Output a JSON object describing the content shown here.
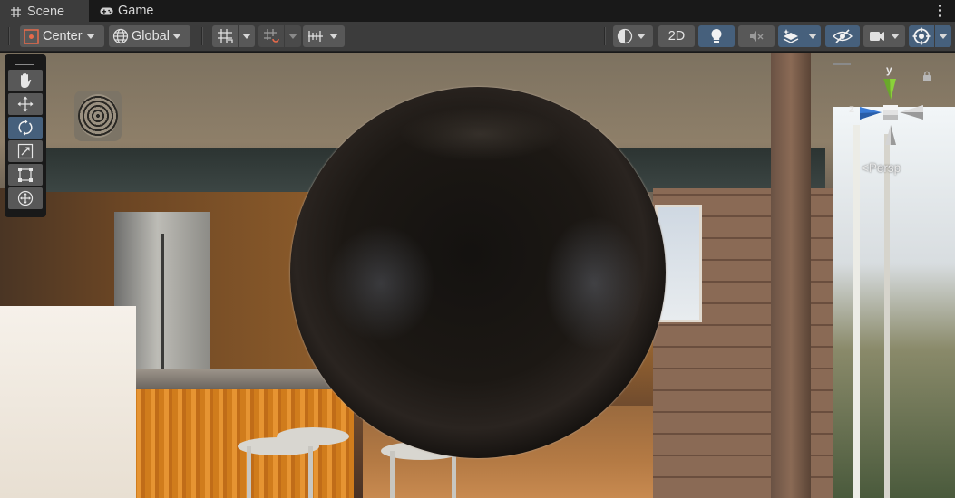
{
  "tabs": [
    {
      "label": "Scene",
      "icon": "grid-icon",
      "active": true
    },
    {
      "label": "Game",
      "icon": "gamepad-icon",
      "active": false
    }
  ],
  "toolbar": {
    "pivot_label": "Center",
    "space_label": "Global",
    "mode_2d_label": "2D"
  },
  "tools": [
    {
      "name": "hand-tool",
      "active": false
    },
    {
      "name": "move-tool",
      "active": false
    },
    {
      "name": "rotate-tool",
      "active": true
    },
    {
      "name": "scale-tool",
      "active": false
    },
    {
      "name": "rect-tool",
      "active": false
    },
    {
      "name": "transform-tool",
      "active": false
    }
  ],
  "gizmo": {
    "y_label": "y",
    "z_label": "z",
    "projection_label": "Persp"
  },
  "colors": {
    "active_accent": "#46607c",
    "toolbar_bg": "#3c3c3c",
    "button_bg": "#585858",
    "gizmo_y": "#8ad13a",
    "gizmo_z": "#3a7bd5",
    "gizmo_x": "#d8d8d8"
  }
}
